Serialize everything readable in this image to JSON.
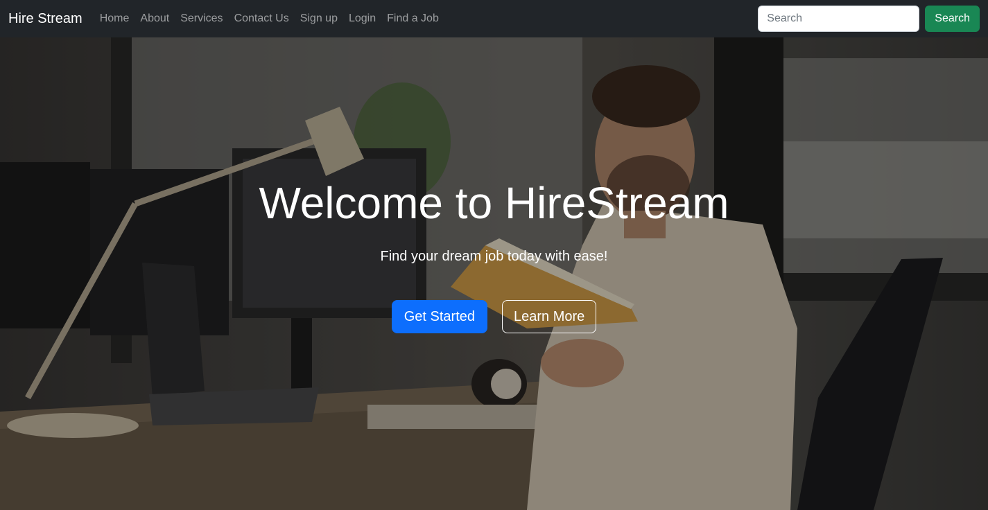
{
  "navbar": {
    "brand": "Hire Stream",
    "links": [
      "Home",
      "About",
      "Services",
      "Contact Us",
      "Sign up",
      "Login",
      "Find a Job"
    ],
    "search": {
      "placeholder": "Search",
      "value": "",
      "button_label": "Search"
    }
  },
  "hero": {
    "title": "Welcome to HireStream",
    "subtitle": "Find your dream job today with ease!",
    "primary_button": "Get Started",
    "secondary_button": "Learn More"
  },
  "colors": {
    "navbar_bg": "#212529",
    "search_button": "#198754",
    "primary_button": "#0d6efd"
  }
}
